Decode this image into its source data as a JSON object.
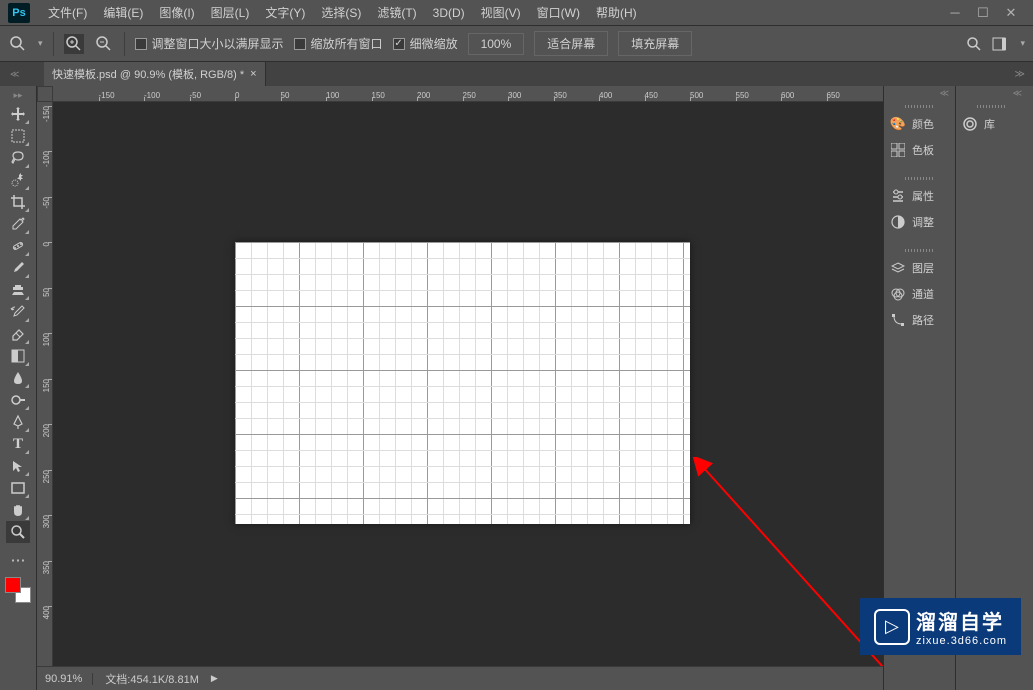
{
  "app": {
    "logo": "Ps"
  },
  "menu": {
    "file": "文件(F)",
    "edit": "编辑(E)",
    "image": "图像(I)",
    "layer": "图层(L)",
    "type": "文字(Y)",
    "select": "选择(S)",
    "filter": "滤镜(T)",
    "threeD": "3D(D)",
    "view": "视图(V)",
    "window": "窗口(W)",
    "help": "帮助(H)"
  },
  "options": {
    "resize_windows": "调整窗口大小以满屏显示",
    "zoom_all": "缩放所有窗口",
    "scrubby_zoom": "细微缩放",
    "zoom_100": "100%",
    "fit_screen": "适合屏幕",
    "fill_screen": "填充屏幕"
  },
  "doc_tab": {
    "title": "快速模板.psd @ 90.9% (模板, RGB/8) *"
  },
  "ruler_h": [
    "-150",
    "-100",
    "-50",
    "0",
    "50",
    "100",
    "150",
    "200",
    "250",
    "300",
    "350",
    "400",
    "450",
    "500",
    "550",
    "600",
    "650"
  ],
  "ruler_v": [
    "-150",
    "-100",
    "-50",
    "0",
    "50",
    "100",
    "150",
    "200",
    "250",
    "300",
    "350",
    "400"
  ],
  "status": {
    "zoom": "90.91%",
    "doc_info": "文档:454.1K/8.81M"
  },
  "panels": {
    "color": "颜色",
    "swatches": "色板",
    "properties": "属性",
    "adjustments": "调整",
    "layers": "图层",
    "channels": "通道",
    "paths": "路径",
    "libraries": "库"
  },
  "watermark": {
    "title": "溜溜自学",
    "sub": "zixue.3d66.com"
  }
}
